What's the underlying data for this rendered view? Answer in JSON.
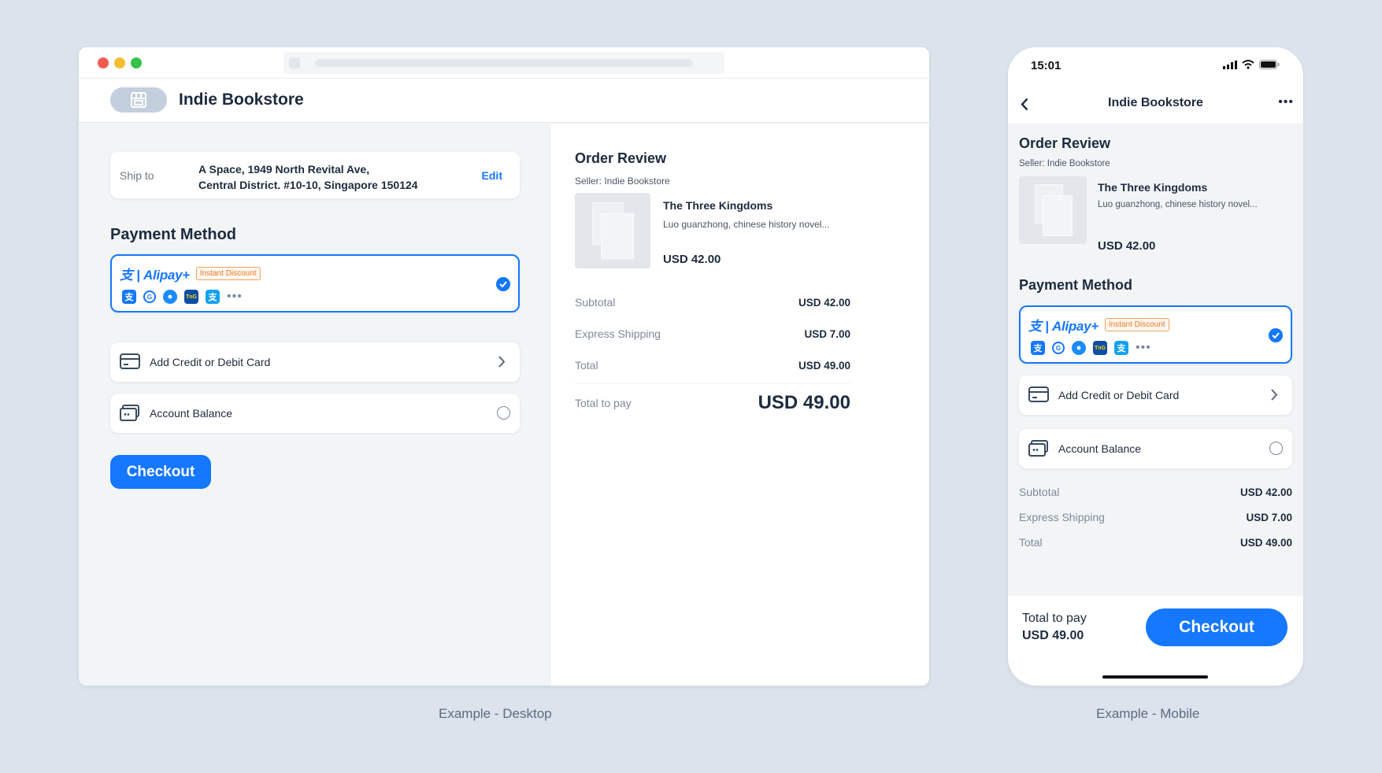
{
  "colors": {
    "accent": "#1677ff",
    "badge": "#f07a23",
    "background": "#dce3ec"
  },
  "desktop": {
    "store_name": "Indie Bookstore",
    "ship": {
      "label": "Ship to",
      "line1": "A Space, 1949 North Revital Ave,",
      "line2": "Central District. #10-10, Singapore 150124",
      "edit": "Edit"
    },
    "payment_title": "Payment Method",
    "alipay": {
      "brand": "Alipay+",
      "badge": "Instant Discount",
      "wallet_icons": [
        "alipay-icon",
        "gcash-icon",
        "dana-icon",
        "touchngo-icon",
        "alipayhk-icon"
      ],
      "selected": true
    },
    "card_option": "Add Credit or Debit Card",
    "balance_option": "Account Balance",
    "checkout": "Checkout",
    "order": {
      "title": "Order Review",
      "seller": "Seller: Indie Bookstore",
      "product_title": "The Three Kingdoms",
      "product_desc": "Luo guanzhong, chinese history novel...",
      "product_price": "USD 42.00",
      "subtotal_label": "Subtotal",
      "subtotal": "USD 42.00",
      "shipping_label": "Express Shipping",
      "shipping": "USD 7.00",
      "total_label": "Total",
      "total": "USD 49.00",
      "to_pay_label": "Total to pay",
      "to_pay": "USD 49.00"
    }
  },
  "mobile": {
    "time": "15:01",
    "store_name": "Indie Bookstore",
    "order_title": "Order Review",
    "seller": "Seller: Indie Bookstore",
    "product_title": "The Three Kingdoms",
    "product_desc": "Luo guanzhong, chinese history novel...",
    "product_price": "USD 42.00",
    "payment_title": "Payment Method",
    "alipay": {
      "brand": "Alipay+",
      "badge": "Instant Discount"
    },
    "card_option": "Add Credit or Debit Card",
    "balance_option": "Account Balance",
    "subtotal_label": "Subtotal",
    "subtotal": "USD 42.00",
    "shipping_label": "Express Shipping",
    "shipping": "USD 7.00",
    "total_label": "Total",
    "total": "USD 49.00",
    "to_pay_label": "Total to pay",
    "to_pay": "USD 49.00",
    "checkout": "Checkout"
  },
  "captions": {
    "desktop": "Example - Desktop",
    "mobile": "Example - Mobile"
  }
}
